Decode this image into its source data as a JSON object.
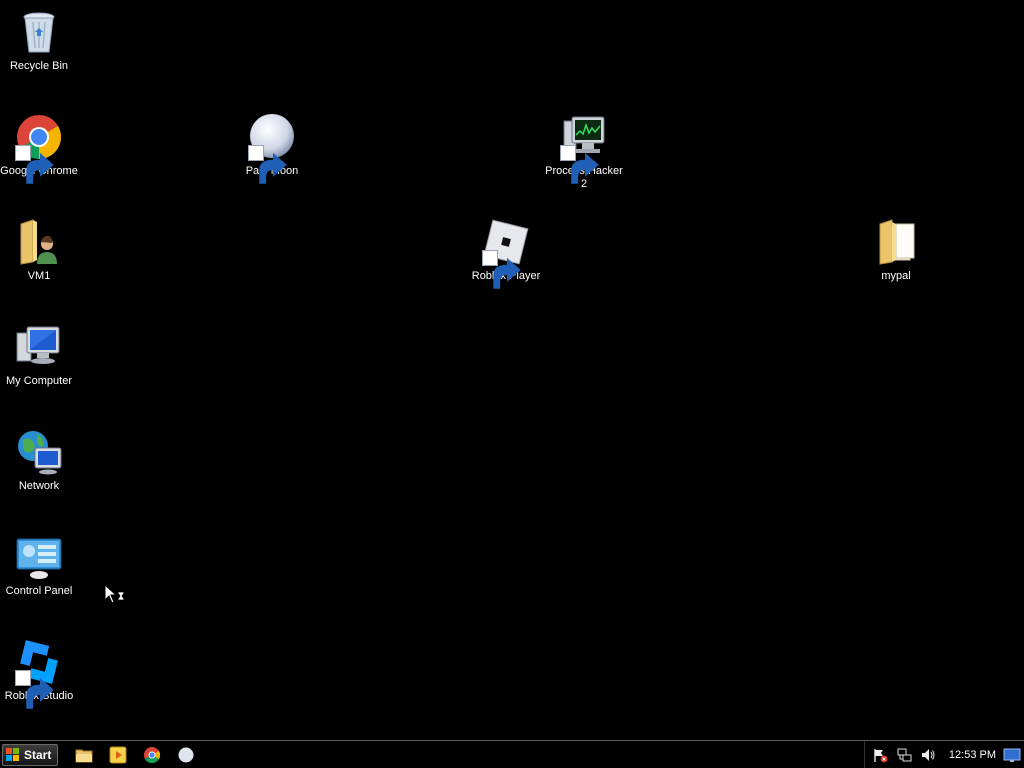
{
  "desktop": {
    "icons": [
      {
        "id": "recycle-bin",
        "label": "Recycle Bin",
        "shortcut": false
      },
      {
        "id": "google-chrome",
        "label": "Google Chrome",
        "shortcut": true
      },
      {
        "id": "pale-moon",
        "label": "Pale Moon",
        "shortcut": true
      },
      {
        "id": "process-hacker",
        "label": "Process Hacker 2",
        "shortcut": true
      },
      {
        "id": "vm1",
        "label": "VM1",
        "shortcut": false
      },
      {
        "id": "roblox-player",
        "label": "Roblox Player",
        "shortcut": true
      },
      {
        "id": "mypal",
        "label": "mypal",
        "shortcut": false
      },
      {
        "id": "my-computer",
        "label": "My Computer",
        "shortcut": false
      },
      {
        "id": "network",
        "label": "Network",
        "shortcut": false
      },
      {
        "id": "control-panel",
        "label": "Control Panel",
        "shortcut": false
      },
      {
        "id": "roblox-studio",
        "label": "Roblox Studio",
        "shortcut": true
      }
    ]
  },
  "taskbar": {
    "start_label": "Start",
    "pinned": [
      "file-explorer-icon",
      "media-player-icon",
      "chrome-icon",
      "pale-moon-icon"
    ],
    "tray": [
      "action-center-flag-icon",
      "network-icon",
      "volume-icon"
    ],
    "clock": "12:53 PM"
  },
  "colors": {
    "desktop_background": "#000000",
    "label_text": "#ffffff",
    "taskbar_background": "#000000"
  }
}
